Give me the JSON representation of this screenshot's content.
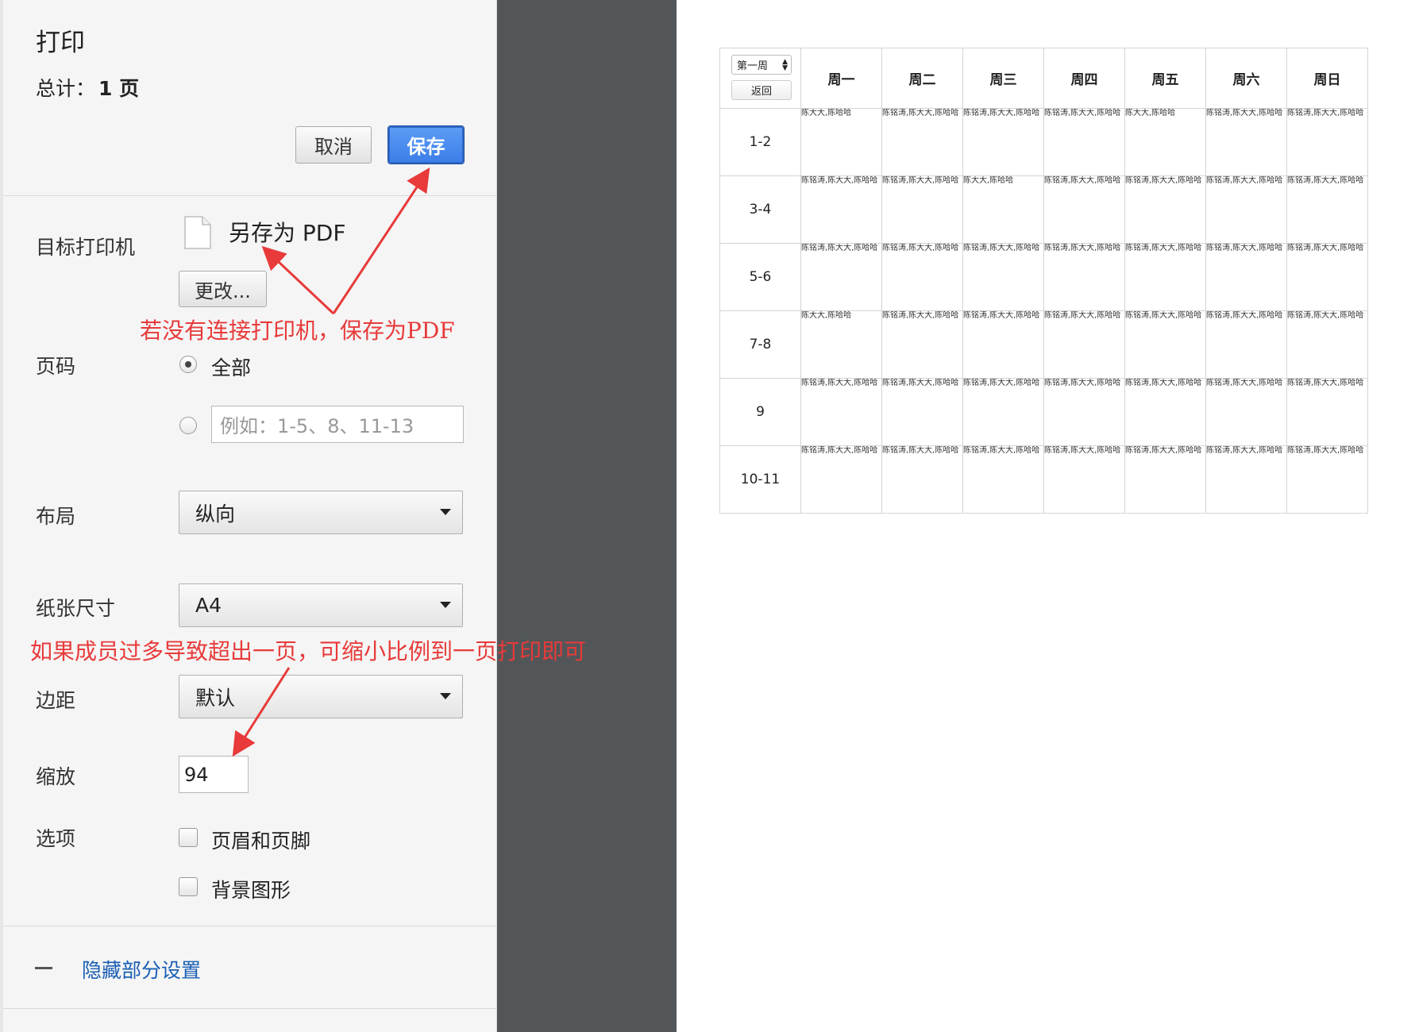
{
  "dialog": {
    "title": "打印",
    "total_label": "总计：",
    "total_value": "1 页",
    "cancel": "取消",
    "save": "保存"
  },
  "settings": {
    "destination_label": "目标打印机",
    "destination_value": "另存为 PDF",
    "change_button": "更改...",
    "pages_label": "页码",
    "pages_all": "全部",
    "pages_placeholder": "例如：1-5、8、11-13",
    "layout_label": "布局",
    "layout_value": "纵向",
    "paper_label": "纸张尺寸",
    "paper_value": "A4",
    "margin_label": "边距",
    "margin_value": "默认",
    "scale_label": "缩放",
    "scale_value": "94",
    "options_label": "选项",
    "option_headers": "页眉和页脚",
    "option_background": "背景图形",
    "hide_settings": "隐藏部分设置"
  },
  "annotations": {
    "note_pdf": "若没有连接打印机，保存为PDF",
    "note_scale": "如果成员过多导致超出一页，可缩小比例到一页打印即可"
  },
  "preview": {
    "week_select": "第一周",
    "back_button": "返回",
    "days": [
      "周一",
      "周二",
      "周三",
      "周四",
      "周五",
      "周六",
      "周日"
    ],
    "rows": [
      {
        "period": "1-2",
        "cells": [
          "陈大大,陈哈哈",
          "陈铭涛,陈大大,陈哈哈",
          "陈铭涛,陈大大,陈哈哈",
          "陈铭涛,陈大大,陈哈哈",
          "陈大大,陈哈哈",
          "陈铭涛,陈大大,陈哈哈",
          "陈铭涛,陈大大,陈哈哈"
        ]
      },
      {
        "period": "3-4",
        "cells": [
          "陈铭涛,陈大大,陈哈哈",
          "陈铭涛,陈大大,陈哈哈",
          "陈大大,陈哈哈",
          "陈铭涛,陈大大,陈哈哈",
          "陈铭涛,陈大大,陈哈哈",
          "陈铭涛,陈大大,陈哈哈",
          "陈铭涛,陈大大,陈哈哈"
        ]
      },
      {
        "period": "5-6",
        "cells": [
          "陈铭涛,陈大大,陈哈哈",
          "陈铭涛,陈大大,陈哈哈",
          "陈铭涛,陈大大,陈哈哈",
          "陈铭涛,陈大大,陈哈哈",
          "陈铭涛,陈大大,陈哈哈",
          "陈铭涛,陈大大,陈哈哈",
          "陈铭涛,陈大大,陈哈哈"
        ]
      },
      {
        "period": "7-8",
        "cells": [
          "陈大大,陈哈哈",
          "陈铭涛,陈大大,陈哈哈",
          "陈铭涛,陈大大,陈哈哈",
          "陈铭涛,陈大大,陈哈哈",
          "陈铭涛,陈大大,陈哈哈",
          "陈铭涛,陈大大,陈哈哈",
          "陈铭涛,陈大大,陈哈哈"
        ]
      },
      {
        "period": "9",
        "cells": [
          "陈铭涛,陈大大,陈哈哈",
          "陈铭涛,陈大大,陈哈哈",
          "陈铭涛,陈大大,陈哈哈",
          "陈铭涛,陈大大,陈哈哈",
          "陈铭涛,陈大大,陈哈哈",
          "陈铭涛,陈大大,陈哈哈",
          "陈铭涛,陈大大,陈哈哈"
        ]
      },
      {
        "period": "10-11",
        "cells": [
          "陈铭涛,陈大大,陈哈哈",
          "陈铭涛,陈大大,陈哈哈",
          "陈铭涛,陈大大,陈哈哈",
          "陈铭涛,陈大大,陈哈哈",
          "陈铭涛,陈大大,陈哈哈",
          "陈铭涛,陈大大,陈哈哈",
          "陈铭涛,陈大大,陈哈哈"
        ]
      }
    ]
  },
  "colors": {
    "primary_button": "#4a8af4",
    "annotation": "#e83a3a",
    "link": "#1a5fb4",
    "preview_background": "#525659"
  }
}
